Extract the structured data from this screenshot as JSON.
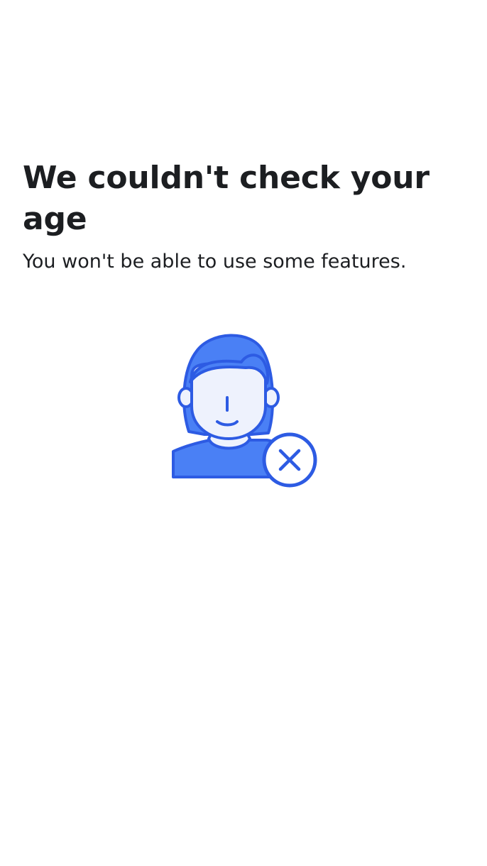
{
  "main": {
    "title": "We couldn't check your age",
    "subtitle": "You won't be able to use some features."
  },
  "illustration": {
    "icon": "person-with-x-icon",
    "badge_icon": "close-circle-icon",
    "colors": {
      "accent": "#4A80F5",
      "stroke": "#2D5BE3",
      "face": "#EEF2FD"
    }
  }
}
